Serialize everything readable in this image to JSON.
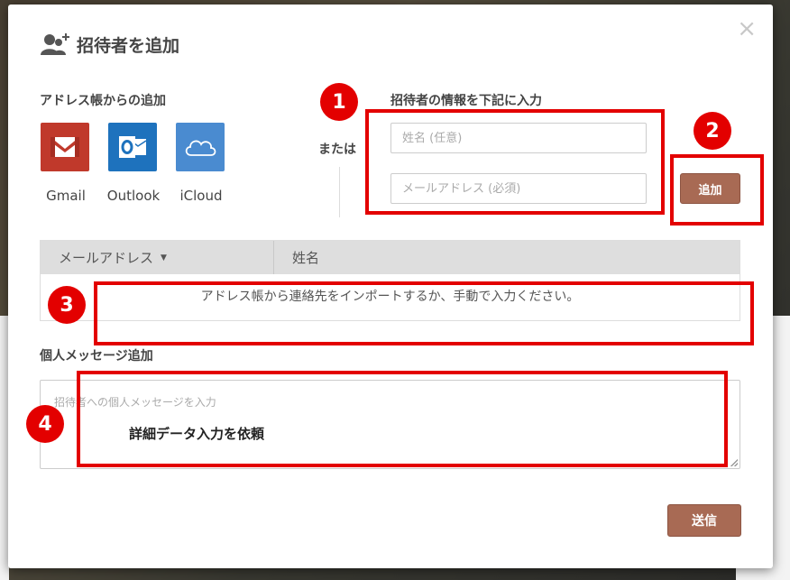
{
  "modal": {
    "title": "招待者を追加",
    "close": "×",
    "addressbook_label": "アドレス帳からの追加",
    "providers": [
      {
        "name": "Gmail",
        "color": "#c0392b"
      },
      {
        "name": "Outlook",
        "color": "#1e72bd"
      },
      {
        "name": "iCloud",
        "color": "#4a8bd0"
      }
    ],
    "or_label": "または",
    "manual_label": "招待者の情報を下記に入力",
    "name_placeholder": "姓名 (任意)",
    "email_placeholder": "メールアドレス (必須)",
    "add_button": "追加",
    "table": {
      "col_email": "メールアドレス",
      "col_name": "姓名",
      "empty_message": "アドレス帳から連絡先をインポートするか、手動で入力ください。"
    },
    "message_label": "個人メッセージ追加",
    "message_placeholder": "招待者への個人メッセージを入力",
    "message_value": "詳細データ入力を依頼",
    "send_button": "送信"
  },
  "annotations": [
    "1",
    "2",
    "3",
    "4"
  ],
  "colors": {
    "accent": "#a86a54",
    "annotation": "#e30000"
  }
}
